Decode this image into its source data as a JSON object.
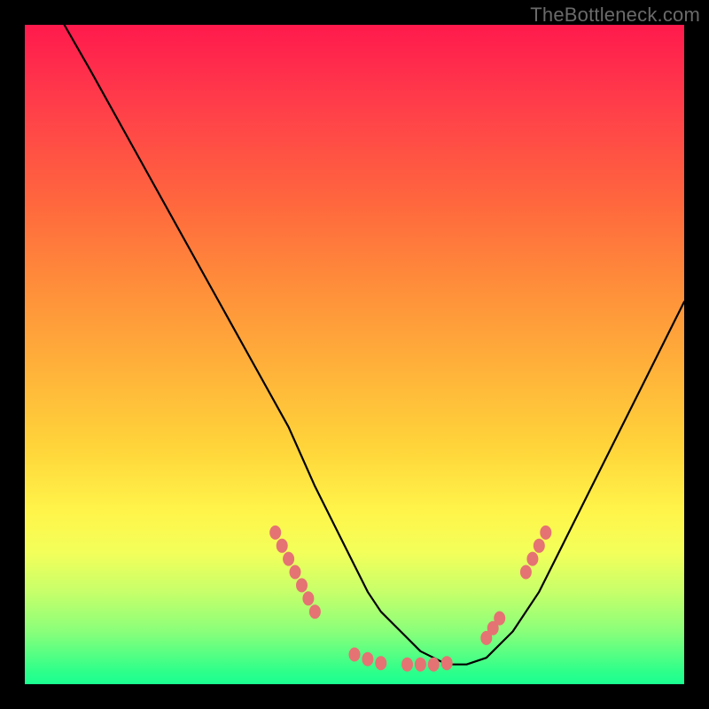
{
  "watermark": "TheBottleneck.com",
  "chart_data": {
    "type": "line",
    "title": "",
    "xlabel": "",
    "ylabel": "",
    "xlim": [
      0,
      100
    ],
    "ylim": [
      0,
      100
    ],
    "grid": false,
    "legend": false,
    "series": [
      {
        "name": "curve",
        "x": [
          6,
          10,
          15,
          20,
          25,
          30,
          35,
          40,
          44,
          48,
          52,
          54,
          56,
          58,
          60,
          62,
          64,
          67,
          70,
          74,
          78,
          82,
          86,
          90,
          94,
          98,
          100
        ],
        "y": [
          100,
          93,
          84,
          75,
          66,
          57,
          48,
          39,
          30,
          22,
          14,
          11,
          9,
          7,
          5,
          4,
          3,
          3,
          4,
          8,
          14,
          22,
          30,
          38,
          46,
          54,
          58
        ]
      }
    ],
    "markers": {
      "name": "highlight-dots",
      "color": "#E57373",
      "points": [
        {
          "x": 38,
          "y": 23
        },
        {
          "x": 39,
          "y": 21
        },
        {
          "x": 40,
          "y": 19
        },
        {
          "x": 41,
          "y": 17
        },
        {
          "x": 42,
          "y": 15
        },
        {
          "x": 43,
          "y": 13
        },
        {
          "x": 44,
          "y": 11
        },
        {
          "x": 50,
          "y": 4.5
        },
        {
          "x": 52,
          "y": 3.8
        },
        {
          "x": 54,
          "y": 3.2
        },
        {
          "x": 58,
          "y": 3
        },
        {
          "x": 60,
          "y": 3
        },
        {
          "x": 62,
          "y": 3
        },
        {
          "x": 64,
          "y": 3.2
        },
        {
          "x": 70,
          "y": 7
        },
        {
          "x": 71,
          "y": 8.5
        },
        {
          "x": 72,
          "y": 10
        },
        {
          "x": 76,
          "y": 17
        },
        {
          "x": 77,
          "y": 19
        },
        {
          "x": 78,
          "y": 21
        },
        {
          "x": 79,
          "y": 23
        }
      ]
    }
  }
}
